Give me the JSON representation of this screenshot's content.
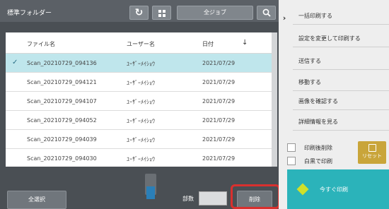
{
  "header": {
    "folder_label": "標準フォルダー",
    "all_jobs_label": "全ジョブ",
    "refresh_icon": "refresh-icon",
    "grid_icon": "grid-icon",
    "search_icon": "search-icon"
  },
  "table": {
    "columns": [
      "ファイル名",
      "ユーザー名",
      "日付"
    ],
    "sort_icon": "sort-down-icon",
    "rows": [
      {
        "filename": "Scan_20210729_094136",
        "user": "ﾕｰｻﾞｰﾒｲｼｮｳ",
        "date": "2021/07/29",
        "selected": true
      },
      {
        "filename": "Scan_20210729_094121",
        "user": "ﾕｰｻﾞｰﾒｲｼｮｳ",
        "date": "2021/07/29",
        "selected": false
      },
      {
        "filename": "Scan_20210729_094107",
        "user": "ﾕｰｻﾞｰﾒｲｼｮｳ",
        "date": "2021/07/29",
        "selected": false
      },
      {
        "filename": "Scan_20210729_094052",
        "user": "ﾕｰｻﾞｰﾒｲｼｮｳ",
        "date": "2021/07/29",
        "selected": false
      },
      {
        "filename": "Scan_20210729_094039",
        "user": "ﾕｰｻﾞｰﾒｲｼｮｳ",
        "date": "2021/07/29",
        "selected": false
      },
      {
        "filename": "Scan_20210729_094030",
        "user": "ﾕｰｻﾞｰﾒｲｼｮｳ",
        "date": "2021/07/29",
        "selected": false
      }
    ]
  },
  "bottom": {
    "select_all_label": "全選択",
    "copies_label": "部数",
    "copies_value": "",
    "delete_label": "削除"
  },
  "right_panel": {
    "menu": [
      "一括印刷する",
      "設定を変更して印刷する",
      "送信する",
      "移動する",
      "画像を確認する",
      "詳細情報を見る"
    ],
    "checkboxes": [
      "印刷後削除",
      "白黒で印刷"
    ],
    "reset_label": "リセット",
    "print_now_label": "今すぐ印刷"
  },
  "colors": {
    "accent": "#2bb3ba",
    "selected_row": "#bfe6ec",
    "highlight": "#d9302e",
    "reset": "#c9a53a"
  }
}
